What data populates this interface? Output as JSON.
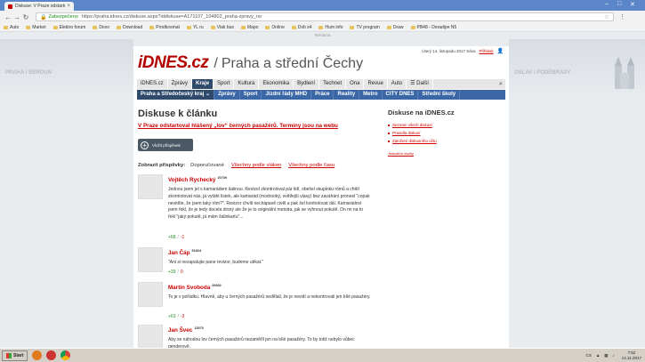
{
  "browser": {
    "tab_title": "Diskuse: V Praze odstartov",
    "tab_close": "×",
    "secure_label": "Zabezpečeno",
    "url": "https://praha.idnes.cz/diskuse.aspx?iddiskuse=A171107_104802_praha-zpravy_rsr",
    "bookmarks": [
      "Auto",
      "Market",
      "Elektro forum",
      "Dovo",
      "Download",
      "Prodkosmat",
      "YL ru",
      "Vlak bus",
      "Mapo",
      "Online",
      "Dvb s4",
      "Hum info",
      "TV program",
      "Draw",
      "PB48 - Doradipe N5"
    ]
  },
  "ad_label": "Reklama",
  "header": {
    "date_text": "Úterý 14. listopadu 2017 Sáva",
    "login": "Přihlásit",
    "logo": "iDNES.cz",
    "slash": "/",
    "region": "Praha a střední Čechy"
  },
  "side_labels": {
    "left": "PRAHA / BEROUN",
    "right": "OSLAV / PODĚBRADY"
  },
  "nav_main": [
    "iDNES.cz",
    "Zprávy",
    "Kraje",
    "Sport",
    "Kultura",
    "Ekonomika",
    "Bydlení",
    "Technet",
    "Ona",
    "Revue",
    "Auto",
    "☰ Další"
  ],
  "nav_main_active_index": 2,
  "nav_sub": [
    "Praha a Středočeský kraj ⌄",
    "Zprávy",
    "Sport",
    "Jízdní řády MHD",
    "Práce",
    "Reality",
    "Metro",
    "CITY DNES",
    "Střední školy"
  ],
  "discussion": {
    "heading": "Diskuse k článku",
    "article_title": "V Praze odstartoval hlášený „lov“ černých pasažérů. Terminy jsou na webu",
    "add_button": "Vložit příspěvek",
    "filter_label": "Zobrazit příspěvky:",
    "filter_options": [
      "Doporučované",
      "Všechny podle vláken",
      "Všechny podle času"
    ]
  },
  "comments": [
    {
      "author": "Vojtěch Rychecký",
      "score": "20709",
      "text": "Jednou jsem jel s kamarádem šalinou. Revizol zkontroloval pár lidí, obešel skupinku rómů a chtěl zkontrolovat nás, já vytáhl lístek, ale kamarád (modrooký, světlejší vlasy) bez zaváhání pronesl \"copak nevidíte, že jsem taky róm?\". Revizor chvíli nechápavě civěl a pak šel kontrolovat dál. Kamarádovi jsem řekl, že je tedy docela drsný ale že je to originální metoda, jak se vyhnout pokutě. On mi na to řekl \"jaký pokutě, já mám šalinkartu\"...",
      "up": "+68",
      "down": "-1"
    },
    {
      "author": "Jan Čáp",
      "score": "51824",
      "text": "\"Ani si nezapalujte pane revizor, budeme utíkat.\"",
      "up": "+39",
      "down": "0"
    },
    {
      "author": "Martin Svoboda",
      "score": "26802",
      "text": "To je v pořádku. Hlavně, aby u černých pasažérů nedělali, že je nevidí a nekontrovali jen bílé pasažéry.",
      "up": "+63",
      "down": "-3"
    },
    {
      "author": "Jan Švec",
      "score": "13570",
      "text": "Aby se náhodou lov černých pasažérů nezaměřil jen na bílé pasažéry. To by totiž nebylo vůbec genderově.",
      "up": "",
      "down": ""
    }
  ],
  "sidebar": {
    "title": "Diskuse na iDNES.cz",
    "links": [
      "Seznam všech diskusí",
      "Pravidla diskusí",
      "Založení diskusního účtu"
    ],
    "small_link": "Jednotlivé služby"
  },
  "taskbar": {
    "start": "Start",
    "lang": "CS",
    "time": "7:52",
    "date": "14.11.2017"
  }
}
